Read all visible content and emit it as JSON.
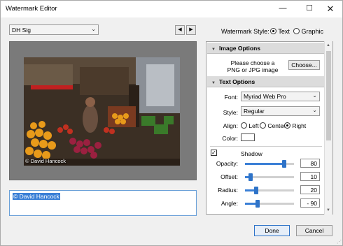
{
  "window": {
    "title": "Watermark Editor",
    "minimize_glyph": "—",
    "maximize_glyph": "☐",
    "close_glyph": "✕"
  },
  "toolbar": {
    "preset_value": "DH Sig",
    "prev_glyph": "◀",
    "next_glyph": "▶",
    "watermark_style_label": "Watermark Style:",
    "style_text_label": "Text",
    "style_graphic_label": "Graphic",
    "selected_style": "Text"
  },
  "preview": {
    "watermark_text": "© David Hancock"
  },
  "editor": {
    "text_value": "© David Hancock"
  },
  "panel": {
    "image_options": {
      "title": "Image Options",
      "hint_line1": "Please choose a",
      "hint_line2": "PNG or JPG image",
      "choose_label": "Choose..."
    },
    "text_options": {
      "title": "Text Options",
      "font_label": "Font:",
      "font_value": "Myriad Web Pro",
      "style_label": "Style:",
      "style_value": "Regular",
      "align_label": "Align:",
      "align_left": "Left",
      "align_center": "Center",
      "align_right": "Right",
      "align_selected": "Right",
      "color_label": "Color:",
      "color_value": "#ffffff"
    },
    "shadow": {
      "label": "Shadow",
      "enabled": true,
      "opacity_label": "Opacity:",
      "opacity_value": "80",
      "offset_label": "Offset:",
      "offset_value": "10",
      "radius_label": "Radius:",
      "radius_value": "20",
      "angle_label": "Angle:",
      "angle_value": "- 90"
    }
  },
  "slider_levels": {
    "opacity": 0.8,
    "offset": 0.12,
    "radius": 0.23,
    "angle": 0.25
  },
  "footer": {
    "done_label": "Done",
    "cancel_label": "Cancel"
  },
  "colors": {
    "accent": "#3a7fd6",
    "selection": "#3a7fd6"
  }
}
